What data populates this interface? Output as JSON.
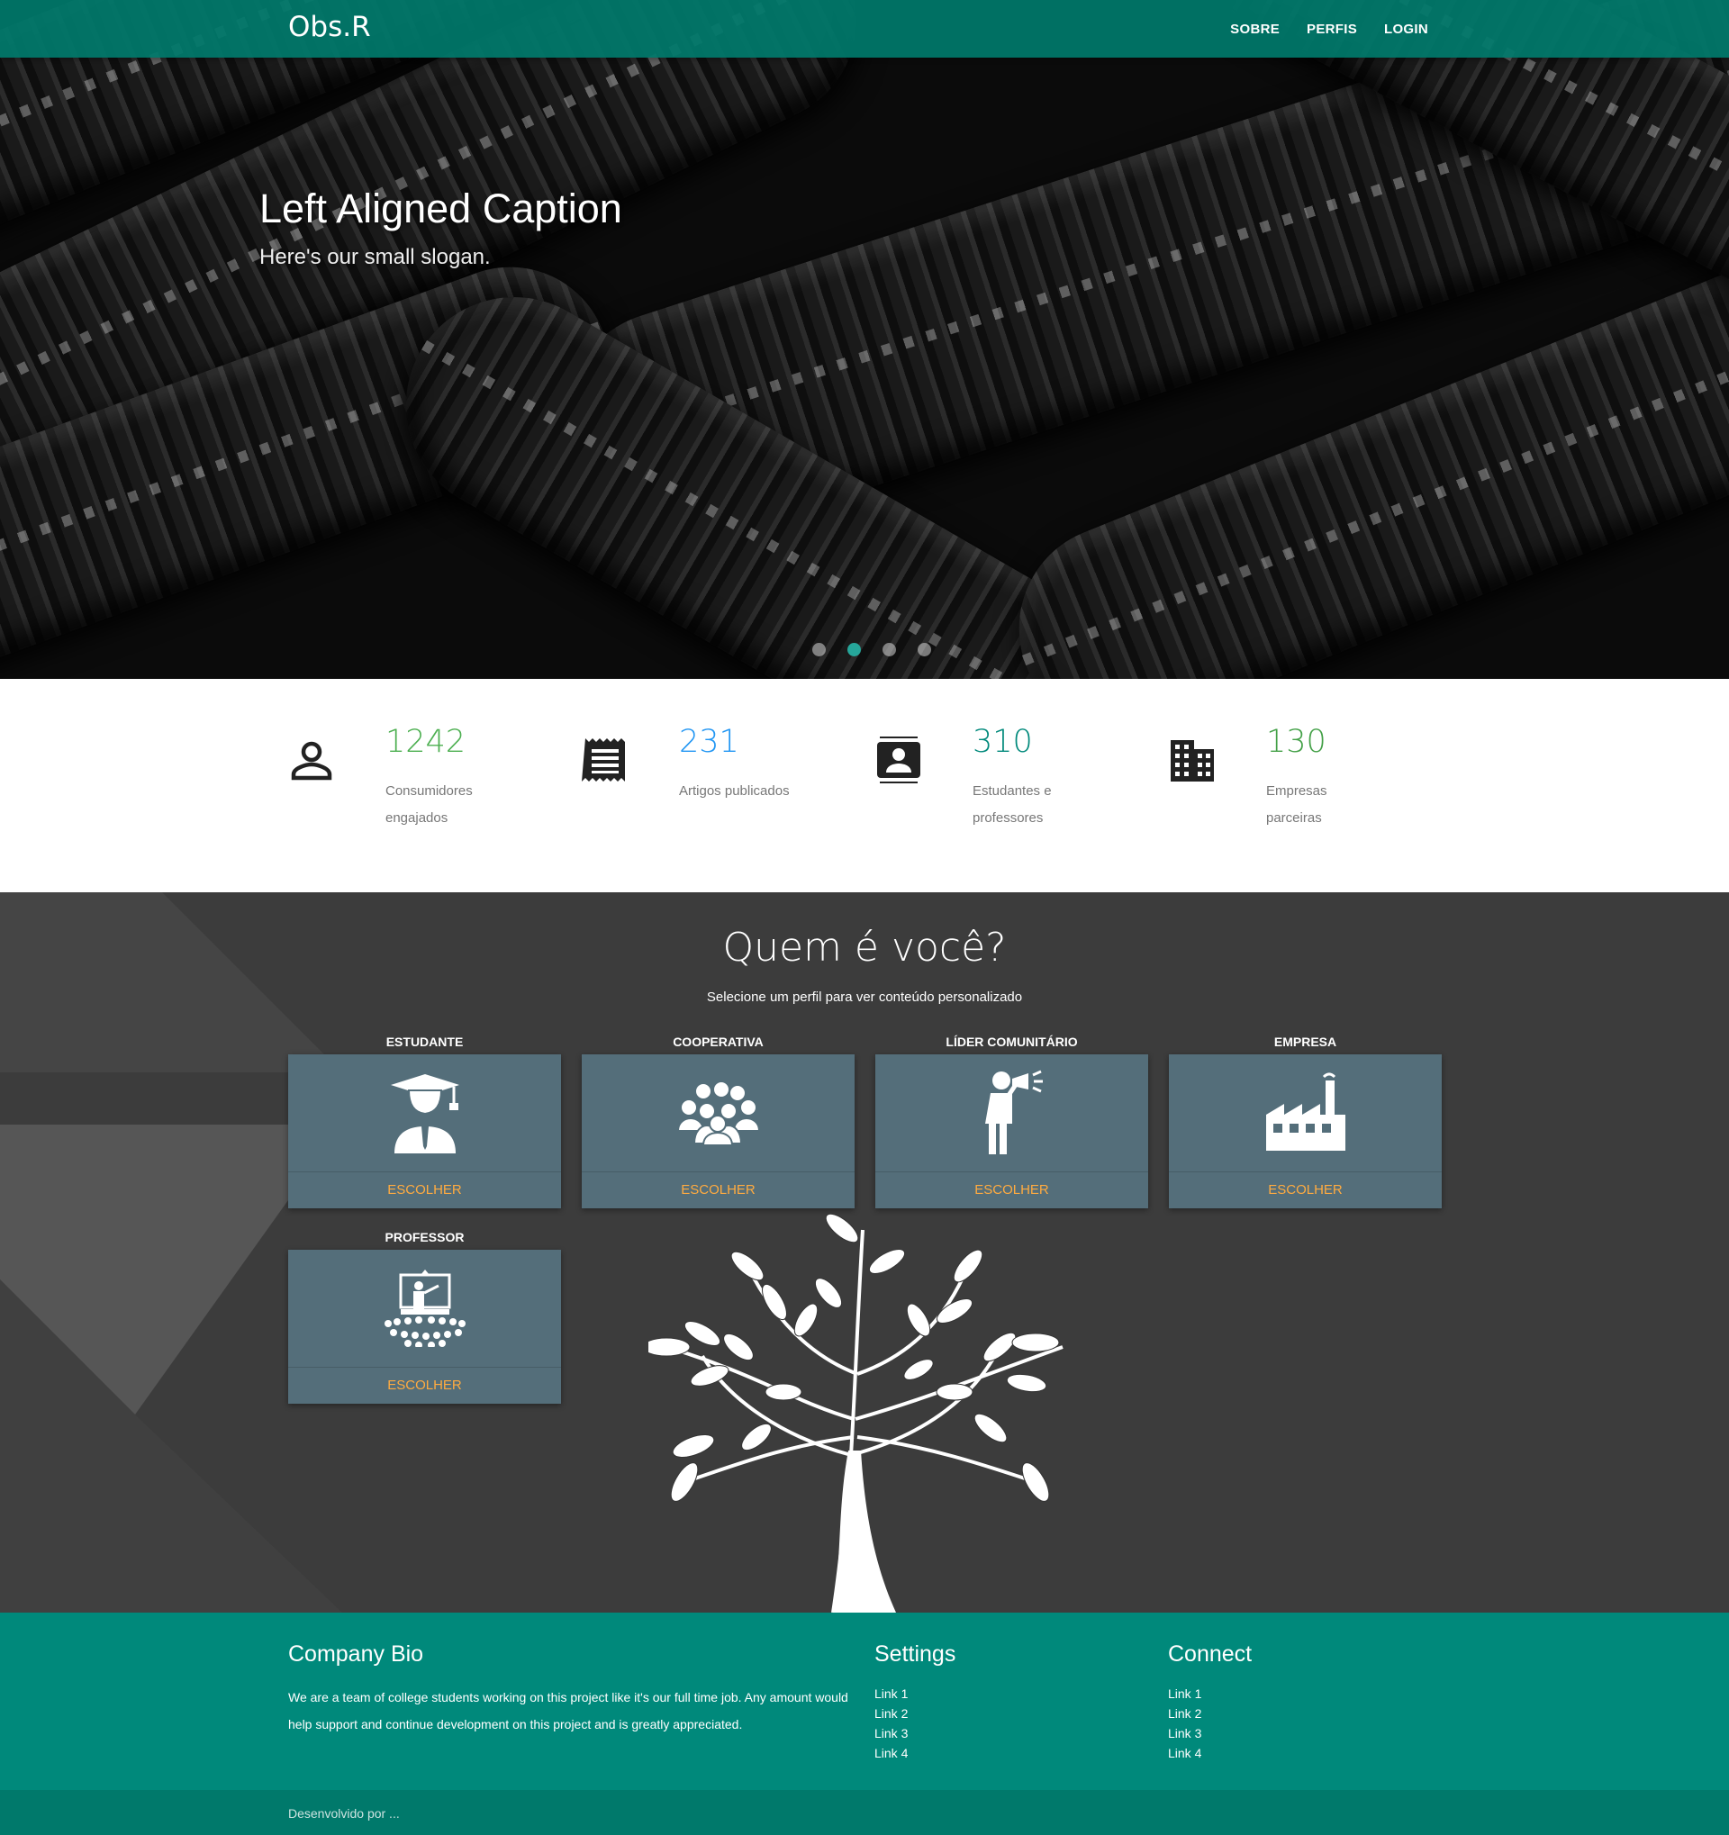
{
  "nav": {
    "brand": "Obs.R",
    "links": [
      "SOBRE",
      "PERFIS",
      "LOGIN"
    ]
  },
  "hero": {
    "title": "Left Aligned Caption",
    "slogan": "Here's our small slogan.",
    "slides": 4,
    "active_slide": 2
  },
  "stats": [
    {
      "icon": "person-icon",
      "value": "1242",
      "label": "Consumidores engajados",
      "color": "#4caf50"
    },
    {
      "icon": "receipt-icon",
      "value": "231",
      "label": "Artigos publicados",
      "color": "#2196f3"
    },
    {
      "icon": "contact-card-icon",
      "value": "310",
      "label": "Estudantes e professores",
      "color": "#00897b"
    },
    {
      "icon": "building-icon",
      "value": "130",
      "label": "Empresas parceiras",
      "color": "#43a047"
    }
  ],
  "profiles": {
    "title": "Quem é você?",
    "subtitle": "Selecione um perfil para ver conteúdo personalizado",
    "cards": [
      {
        "title": "ESTUDANTE",
        "action": "ESCOLHER",
        "icon": "graduate-icon"
      },
      {
        "title": "COOPERATIVA",
        "action": "ESCOLHER",
        "icon": "group-icon"
      },
      {
        "title": "LÍDER COMUNITÁRIO",
        "action": "ESCOLHER",
        "icon": "megaphone-person-icon"
      },
      {
        "title": "EMPRESA",
        "action": "ESCOLHER",
        "icon": "factory-icon"
      },
      {
        "title": "PROFESSOR",
        "action": "ESCOLHER",
        "icon": "teacher-icon"
      }
    ]
  },
  "footer": {
    "bio_title": "Company Bio",
    "bio_text": "We are a team of college students working on this project like it's our full time job. Any amount would help support and continue development on this project and is greatly appreciated.",
    "settings_title": "Settings",
    "settings_links": [
      "Link 1",
      "Link 2",
      "Link 3",
      "Link 4"
    ],
    "connect_title": "Connect",
    "connect_links": [
      "Link 1",
      "Link 2",
      "Link 3",
      "Link 4"
    ],
    "copyright": "Desenvolvido por ..."
  },
  "colors": {
    "nav": "#00796b",
    "footer": "#00897b",
    "card": "#546e7a",
    "action": "#ffab40",
    "dark_bg": "#3c3c3c"
  }
}
